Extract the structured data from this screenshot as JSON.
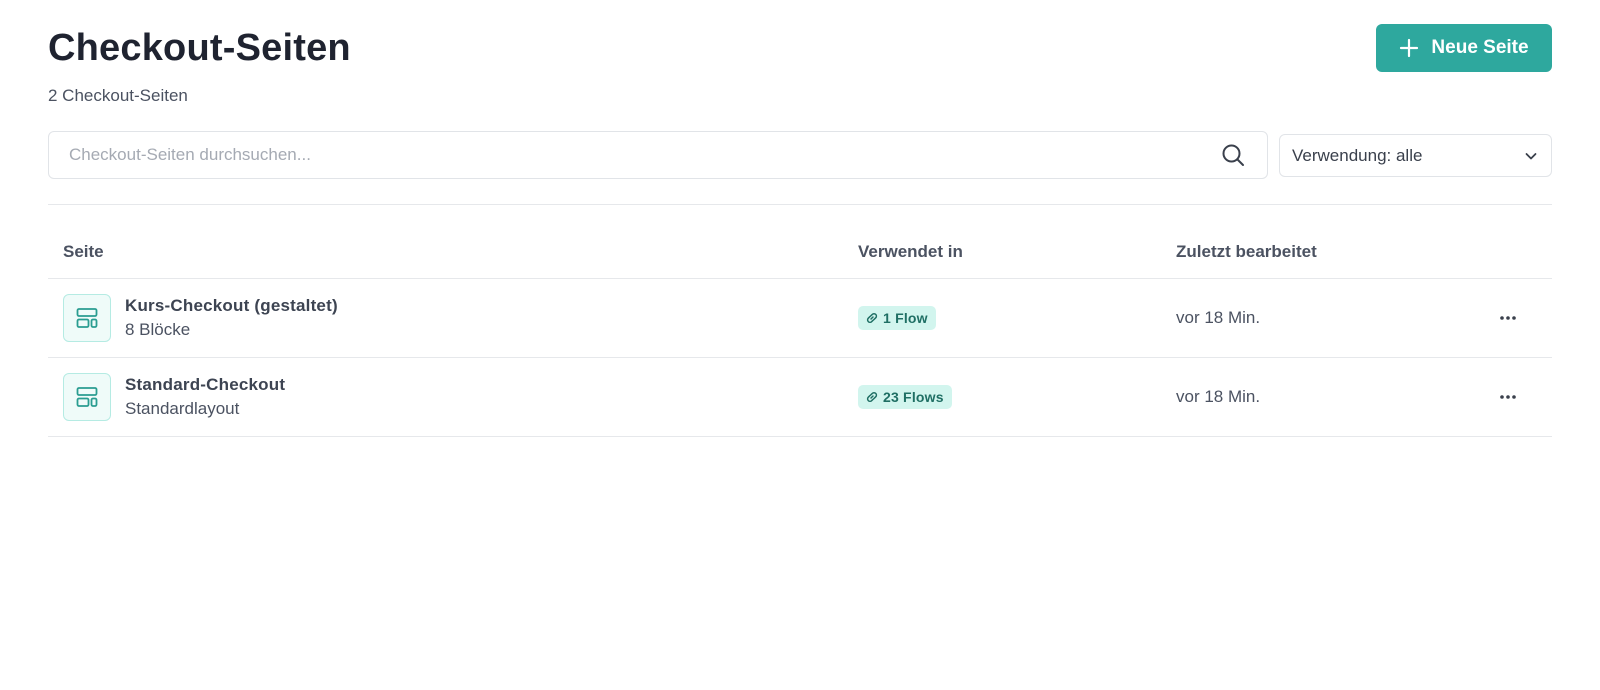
{
  "header": {
    "title": "Checkout-Seiten",
    "count_text": "2 Checkout-Seiten",
    "new_button_label": "Neue Seite",
    "new_button_icon": "plus-icon"
  },
  "search": {
    "placeholder": "Checkout-Seiten durchsuchen...",
    "value": "",
    "icon": "search-icon"
  },
  "filter": {
    "selected": "Verwendung: alle",
    "icon": "chevron-down-icon"
  },
  "table": {
    "columns": [
      "Seite",
      "Verwendet in",
      "Zuletzt bearbeitet"
    ],
    "rows": [
      {
        "name": "Kurs-Checkout (gestaltet)",
        "meta": "8 Blöcke",
        "usage": "1 Flow",
        "edited": "vor 18 Min.",
        "icon": "layout-icon"
      },
      {
        "name": "Standard-Checkout",
        "meta": "Standardlayout",
        "usage": "23 Flows",
        "edited": "vor 18 Min.",
        "icon": "layout-icon"
      }
    ]
  },
  "colors": {
    "accent": "#2ea89e",
    "badge_bg": "#d2f5ee",
    "badge_text": "#1f6f64",
    "icon_tile_bg": "#effbf9",
    "icon_tile_border": "#b5ebe3"
  }
}
